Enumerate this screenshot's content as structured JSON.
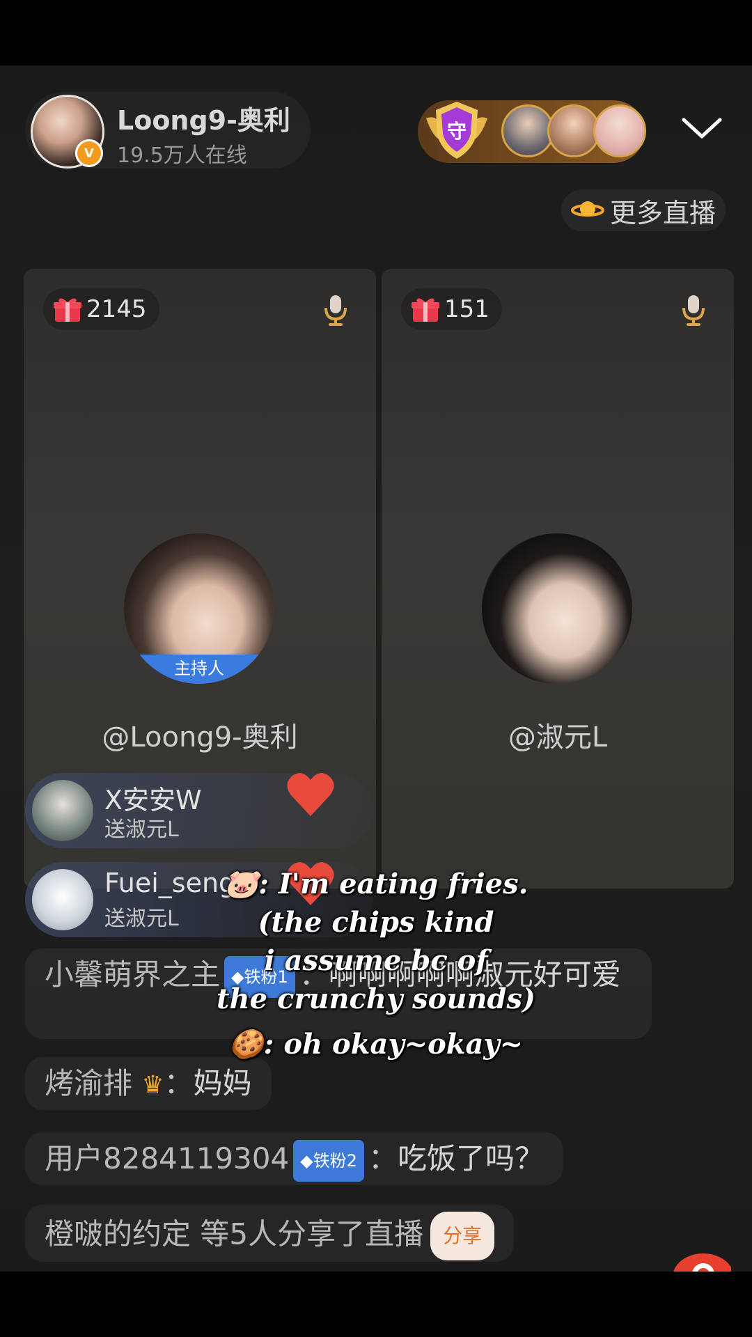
{
  "header": {
    "host_name": "Loong9-奥利",
    "online_count": "19.5万人在线",
    "more_live_label": "更多直播"
  },
  "seats": [
    {
      "gift_count": "2145",
      "host_tag": "主持人",
      "name": "@Loong9-奥利"
    },
    {
      "gift_count": "151",
      "name": "@淑元L"
    }
  ],
  "gift_notices": [
    {
      "user": "X安安W",
      "text": "送淑元L"
    },
    {
      "user": "Fuei_seng",
      "text": "送淑元L"
    }
  ],
  "chat": [
    {
      "user": "小馨萌界之主",
      "badge": "铁粉1",
      "sep": "：",
      "message": "啊啊啊啊啊淑元好可爱"
    },
    {
      "user": "烤渝排",
      "sep": "：",
      "message": "妈妈"
    },
    {
      "user": "用户8284119304",
      "badge": "铁粉2",
      "sep": "：",
      "message": "吃饭了吗？"
    },
    {
      "system": "橙啵的约定 等5人分享了直播",
      "button": "分享"
    }
  ],
  "caption": {
    "line1": "🐷: I'm eating fries.",
    "line2": "(the chips kind",
    "line3": "i assume bc of",
    "line4": "the crunchy sounds)",
    "line5": "🍪: oh okay~okay~"
  },
  "colors": {
    "accent_blue": "#3b7be0",
    "gold": "#d9a44a",
    "share_orange": "#e2742a"
  }
}
